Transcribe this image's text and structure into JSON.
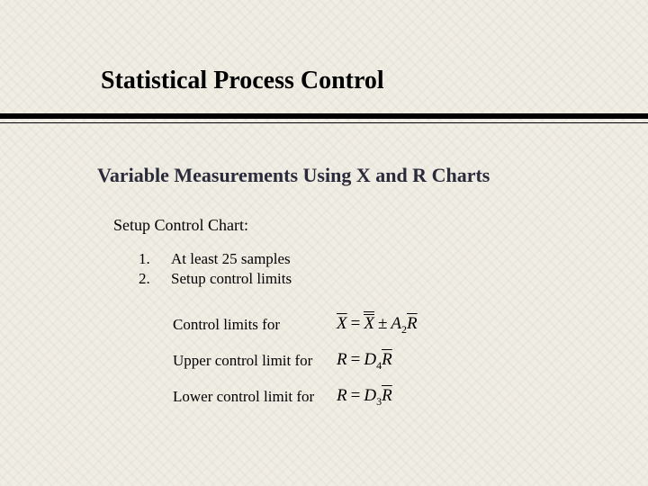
{
  "title": "Statistical Process Control",
  "subtitle": "Variable Measurements Using X and R Charts",
  "section_label": "Setup Control Chart:",
  "list": {
    "n1": "1.",
    "n2": "2.",
    "item1": "At least 25 samples",
    "item2": "Setup control limits"
  },
  "limits": {
    "row1_label": "Control limits for",
    "row2_label": "Upper control limit for",
    "row3_label": "Lower control limit for"
  },
  "formulas": {
    "f1": {
      "lhs_var": "X",
      "rhs1_var": "X",
      "coef": "A",
      "coef_sub": "2",
      "rhs2_var": "R"
    },
    "f2": {
      "lhs_var": "R",
      "coef": "D",
      "coef_sub": "4",
      "rhs_var": "R"
    },
    "f3": {
      "lhs_var": "R",
      "coef": "D",
      "coef_sub": "3",
      "rhs_var": "R"
    }
  }
}
